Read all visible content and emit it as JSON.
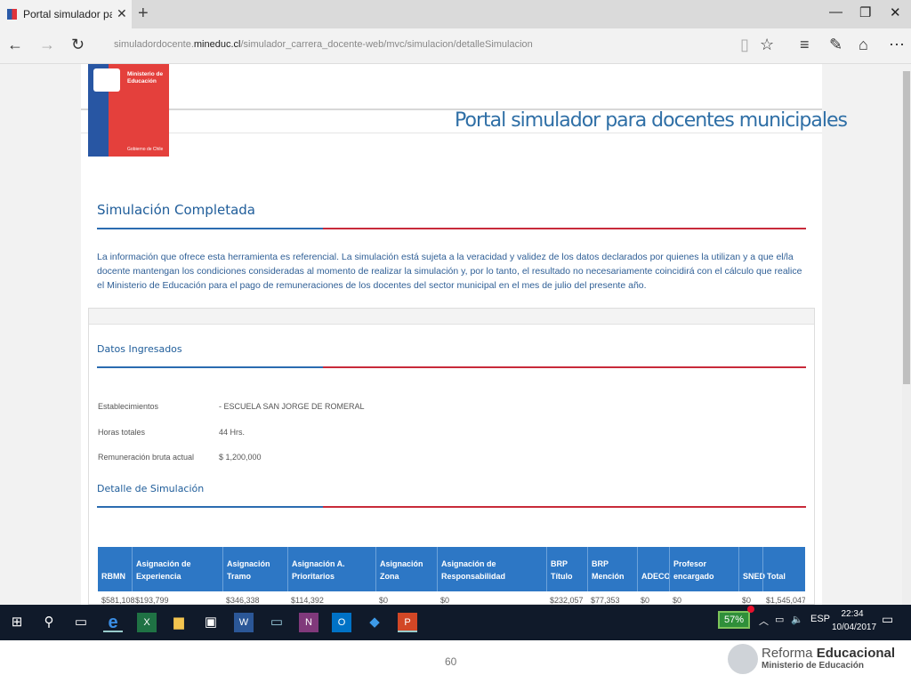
{
  "browser": {
    "tab_title": "Portal simulador para do",
    "url_prefix": "simuladordocente.",
    "url_domain": "mineduc.cl",
    "url_path": "/simulador_carrera_docente-web/mvc/simulacion/detalleSimulacion",
    "icons": [
      "back-icon",
      "forward-icon",
      "refresh-icon",
      "reading-view-icon",
      "favorite-star-icon",
      "hub-icon",
      "web-note-icon",
      "share-icon",
      "more-icon",
      "minimize-icon",
      "restore-icon",
      "close-icon"
    ]
  },
  "header": {
    "logo_line1": "Ministerio de",
    "logo_line2": "Educación",
    "logo_footer": "Gobierno de Chile",
    "title": "Portal simulador para docentes municipales"
  },
  "main": {
    "section_title": "Simulación Completada",
    "disclaimer": "La información que ofrece esta herramienta es referencial. La simulación está sujeta a la veracidad y validez de los datos declarados por quienes la utilizan y a que el/la docente mantengan los condiciones consideradas al momento de realizar la simulación y, por lo tanto, el resultado no necesariamente coincidirá con el cálculo que realice el Ministerio de Educación para el pago de remuneraciones de los docentes del sector municipal en el mes de julio del presente año."
  },
  "datos": {
    "title": "Datos Ingresados",
    "establecimientos_label": "Establecimientos",
    "establecimientos_value": "- ESCUELA SAN JORGE DE ROMERAL",
    "horas_label": "Horas totales",
    "horas_value": "44 Hrs.",
    "remuneracion_label": "Remuneración bruta actual",
    "remuneracion_value": "$ 1,200,000"
  },
  "detalle": {
    "title": "Detalle de Simulación",
    "columns": [
      "RBMN",
      "Asignación de Experiencia",
      "Asignación Tramo",
      "Asignación A. Prioritarios",
      "Asignación Zona",
      "Asignación de Responsabilidad",
      "BRP Título",
      "BRP Mención",
      "ADECO",
      "Profesor encargado",
      "SNED",
      "Total"
    ],
    "row": [
      "$581,108",
      "$193,799",
      "$346,338",
      "$114,392",
      "$0",
      "$0",
      "$232,057",
      "$77,353",
      "$0",
      "$0",
      "$0",
      "$1,545,047"
    ]
  },
  "taskbar": {
    "battery": "57%",
    "lang": "ESP",
    "time": "22:34",
    "date": "10/04/2017",
    "apps": [
      "windows-start-icon",
      "search-icon",
      "task-view-icon",
      "edge-icon",
      "excel-icon",
      "file-explorer-icon",
      "store-icon",
      "word-icon",
      "monitor-icon",
      "onenote-icon",
      "outlook-icon",
      "dropbox-icon",
      "powerpoint-icon"
    ]
  },
  "slide": {
    "page_number": "60",
    "brand_line1a": "Reforma ",
    "brand_line1b": "Educacional",
    "brand_line2": "Ministerio de Educación"
  }
}
